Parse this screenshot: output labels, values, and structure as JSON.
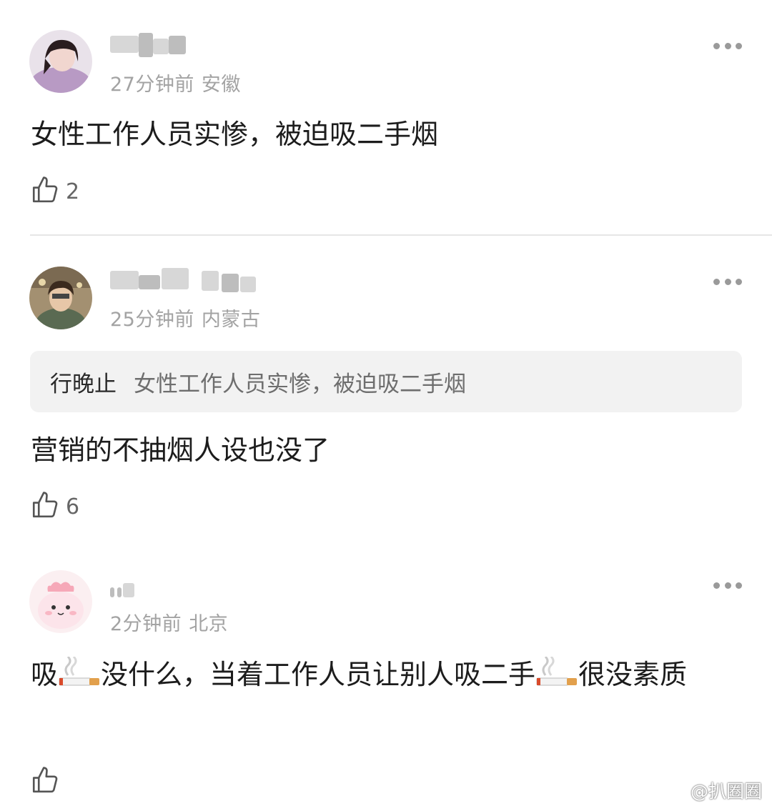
{
  "comments": [
    {
      "time": "27分钟前",
      "location": "安徽",
      "text": "女性工作人员实惨，被迫吸二手烟",
      "likes": "2"
    },
    {
      "time": "25分钟前",
      "location": "内蒙古",
      "quote": {
        "author": "行晚止",
        "text": "女性工作人员实惨，被迫吸二手烟"
      },
      "text": "营销的不抽烟人设也没了",
      "likes": "6"
    },
    {
      "time": "2分钟前",
      "location": "北京",
      "text_parts": [
        "吸",
        "没什么，当着工作人员让别人吸二手",
        "很没素质"
      ],
      "likes": ""
    }
  ],
  "icons": {
    "more": "more-dots-icon",
    "like": "thumbs-up-icon",
    "smoking": "cigarette-emoji-icon",
    "watermark": "weibo-logo-icon"
  },
  "watermark": {
    "text": "@扒圈圈"
  }
}
